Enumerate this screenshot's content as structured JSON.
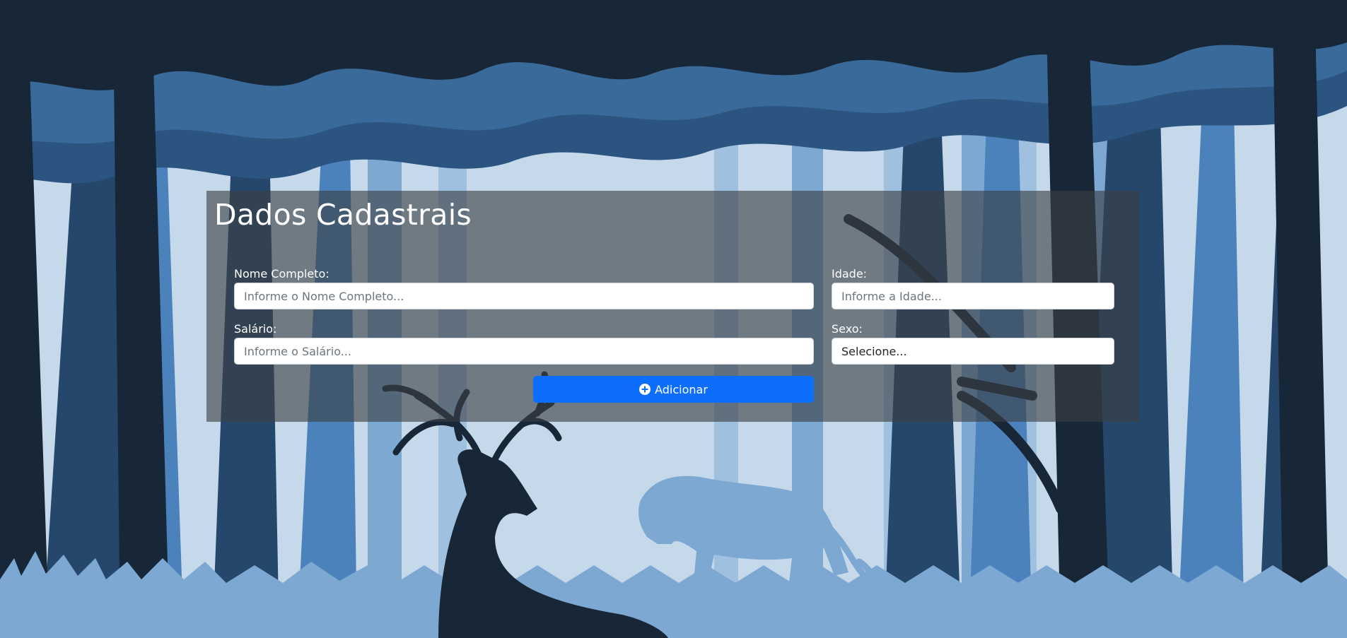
{
  "form": {
    "title": "Dados Cadastrais",
    "fields": {
      "name": {
        "label": "Nome Completo:",
        "placeholder": "Informe o Nome Completo..."
      },
      "age": {
        "label": "Idade:",
        "placeholder": "Informe a Idade..."
      },
      "salary": {
        "label": "Salário:",
        "placeholder": "Informe o Salário..."
      },
      "sex": {
        "label": "Sexo:",
        "selected": "Selecione..."
      }
    },
    "add_button": {
      "label": "Adicionar",
      "icon": "plus-circle-icon"
    }
  },
  "colors": {
    "sky": "#c6d9ea",
    "dark_tree": "#172738",
    "mid_tree": "#24476b",
    "light_tree": "#4b82bb",
    "pale_tree": "#7da8d2",
    "panel_overlay": "rgba(59,63,68,0.62)",
    "button": "#0d6efd"
  }
}
